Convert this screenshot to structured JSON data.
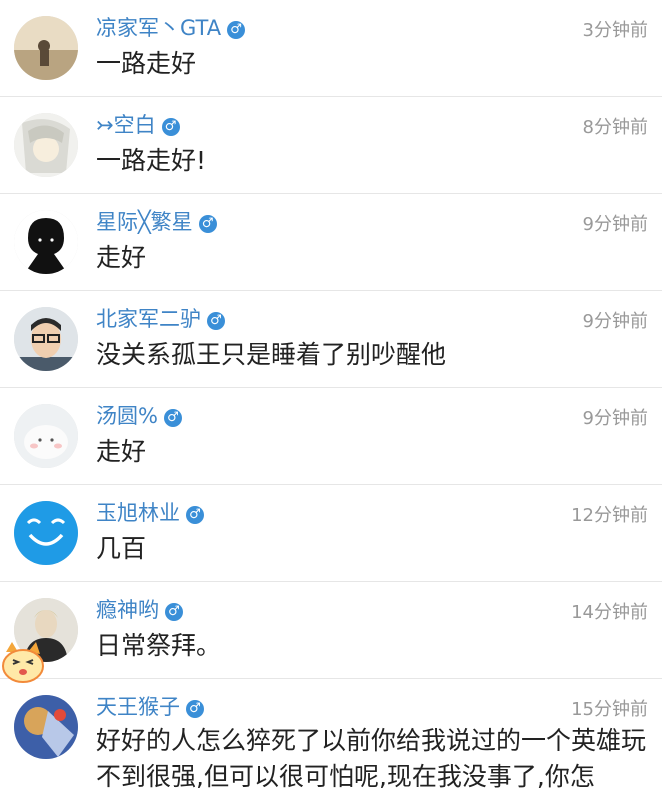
{
  "colors": {
    "name": "#3f84c6",
    "time": "#999999",
    "text": "#222222",
    "gender_badge": "#3a8fd8"
  },
  "comments": [
    {
      "name": "凉家军丶GTA",
      "gender_icon": "male-icon",
      "gender_glyph": "♂",
      "time": "3分钟前",
      "text": "一路走好"
    },
    {
      "name": "↣空白",
      "gender_icon": "male-icon",
      "gender_glyph": "♂",
      "time": "8分钟前",
      "text": "一路走好!"
    },
    {
      "name": "星际╳繁星",
      "gender_icon": "male-icon",
      "gender_glyph": "♂",
      "time": "9分钟前",
      "text": "走好"
    },
    {
      "name": "北家军二驴",
      "gender_icon": "male-icon",
      "gender_glyph": "♂",
      "time": "9分钟前",
      "text": "没关系孤王只是睡着了别吵醒他"
    },
    {
      "name": "汤圆%",
      "gender_icon": "male-icon",
      "gender_glyph": "♂",
      "time": "9分钟前",
      "text": "走好"
    },
    {
      "name": "玉旭林业",
      "gender_icon": "male-icon",
      "gender_glyph": "♂",
      "time": "12分钟前",
      "text": "几百"
    },
    {
      "name": "瘾神哟",
      "gender_icon": "male-icon",
      "gender_glyph": "♂",
      "time": "14分钟前",
      "text": "日常祭拜。"
    },
    {
      "name": "天王猴子",
      "gender_icon": "male-icon",
      "gender_glyph": "♂",
      "time": "15分钟前",
      "text": "好好的人怎么猝死了以前你给我说过的一个英雄玩不到很强,但可以很可怕呢,现在我没事了,你怎"
    }
  ]
}
